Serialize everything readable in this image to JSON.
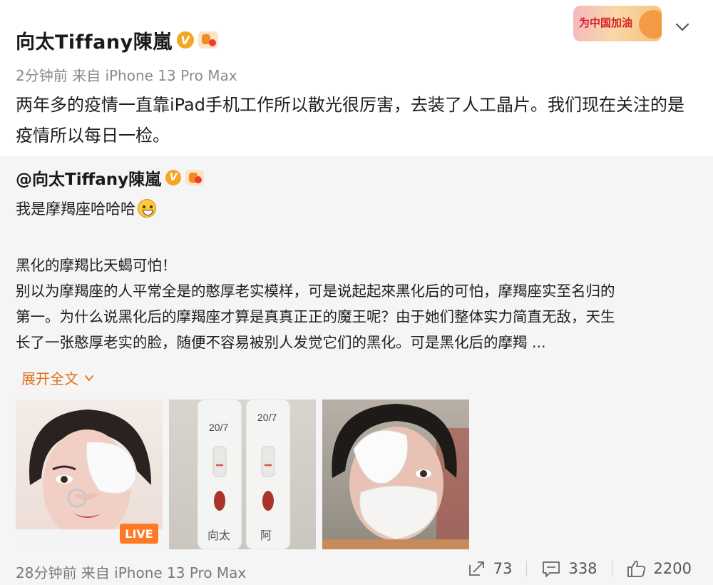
{
  "post": {
    "author": "向太Tiffany陳嵐",
    "verified_badge": "V",
    "event_badge": "为中国加油",
    "meta": "2分钟前  来自 iPhone 13 Pro Max",
    "text": "两年多的疫情一直靠iPad手机工作所以散光很厉害，去装了人工晶片。我们现在关注的是疫情所以每日一检。"
  },
  "repost": {
    "mention": "@向太Tiffany陳嵐",
    "verified_badge": "V",
    "line1": "我是摩羯座哈哈哈",
    "body": [
      "黑化的摩羯比天蝎可怕！",
      "别以为摩羯座的人平常全是的憨厚老实模样，可是说起起來黑化后的可怕，摩羯座实至名归的",
      "第一。为什么说黑化后的摩羯座才算是真真正正的魔王呢？由于她们整体实力简直无敌，天生",
      "长了一张憨厚老实的脸，随便不容易被别人发觉它们的黑化。可是黑化后的摩羯 ..."
    ],
    "expand_label": "展开全文",
    "images": [
      {
        "icon": "photo-eye-patch-selfie",
        "live_label": "LIVE"
      },
      {
        "icon": "photo-test-strips",
        "strip_labels": [
          "20/7",
          "20/7",
          "向太",
          "阿"
        ]
      },
      {
        "icon": "photo-masked-selfie"
      }
    ],
    "meta": "28分钟前  来自 iPhone 13 Pro Max",
    "actions": {
      "repost_count": "73",
      "comment_count": "338",
      "like_count": "2200"
    }
  },
  "colors": {
    "accent_orange": "#e0701c",
    "live_tag": "#ff7a26",
    "repost_bg": "#f5f5f5",
    "badge_v": "#f5a623"
  }
}
